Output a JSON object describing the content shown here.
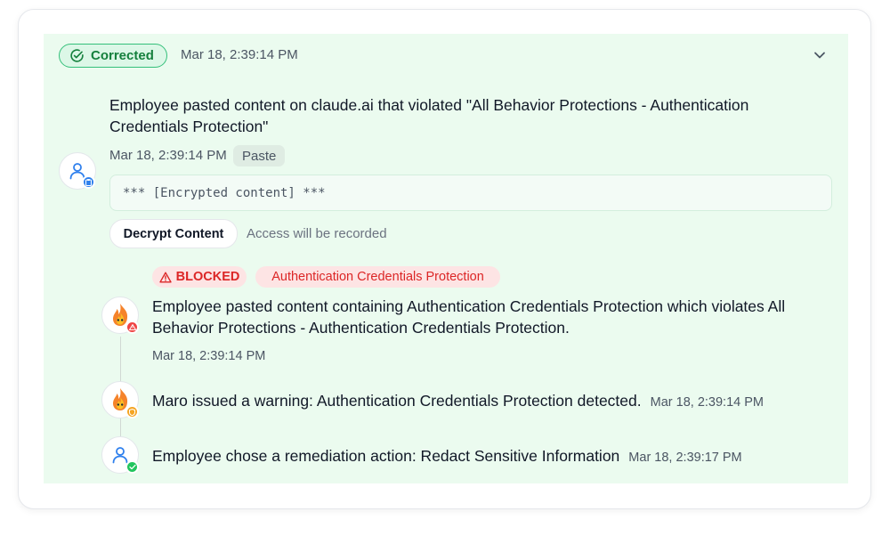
{
  "status": {
    "label": "Corrected",
    "timestamp": "Mar 18, 2:39:14 PM",
    "color": "#15803d"
  },
  "incident": {
    "headline": "Employee pasted content on claude.ai that violated \"All Behavior Protections - Authentication Credentials Protection\"",
    "timestamp": "Mar 18, 2:39:14 PM",
    "type_tag": "Paste",
    "encrypted_preview": "*** [Encrypted content] ***",
    "decrypt_button": "Decrypt Content",
    "access_note": "Access will be recorded"
  },
  "tags": {
    "blocked": "BLOCKED",
    "policy": "Authentication Credentials Protection",
    "color": "#dc2626"
  },
  "events": [
    {
      "text": "Employee pasted content containing Authentication Credentials Protection which violates All Behavior Protections - Authentication Credentials Protection.",
      "timestamp": "Mar 18, 2:39:14 PM",
      "avatar": "maro-flame-avatar",
      "badge": "warning-badge-icon"
    },
    {
      "text": "Maro issued a warning: Authentication Credentials Protection detected.",
      "timestamp": "Mar 18, 2:39:14 PM",
      "avatar": "maro-flame-avatar",
      "badge": "shield-badge-icon"
    },
    {
      "text": "Employee chose a remediation action: Redact Sensitive Information",
      "timestamp": "Mar 18, 2:39:17 PM",
      "avatar": "user-avatar",
      "badge": "check-badge-icon"
    }
  ],
  "colors": {
    "panel_bg": "#ebfbef",
    "accent_green": "#22c55e",
    "accent_blue": "#2f80ed",
    "danger_red": "#ef4444",
    "warning_amber": "#f5a524"
  }
}
